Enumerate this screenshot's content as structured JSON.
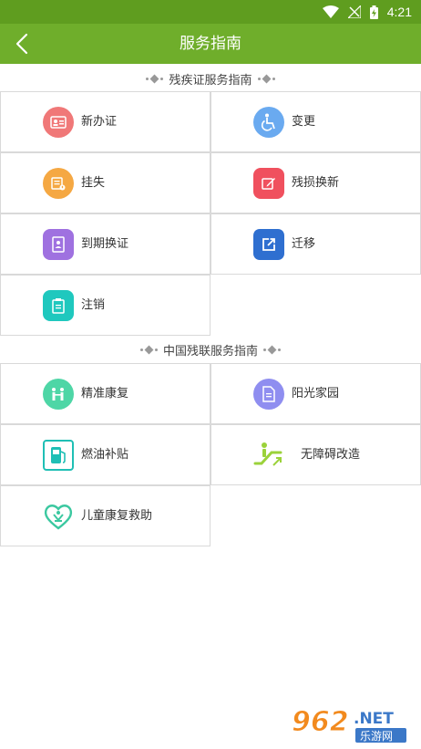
{
  "status": {
    "time": "4:21"
  },
  "header": {
    "title": "服务指南"
  },
  "sections": [
    {
      "title": "残疾证服务指南",
      "items": [
        {
          "label": "新办证",
          "icon": "id-card-icon",
          "color": "#f07878"
        },
        {
          "label": "变更",
          "icon": "wheelchair-icon",
          "color": "#6aaaf0"
        },
        {
          "label": "挂失",
          "icon": "report-loss-icon",
          "color": "#f5a843"
        },
        {
          "label": "残损换新",
          "icon": "edit-icon",
          "color": "#f0505e"
        },
        {
          "label": "到期换证",
          "icon": "contact-book-icon",
          "color": "#9f71e0"
        },
        {
          "label": "迁移",
          "icon": "transfer-icon",
          "color": "#2f6fd0"
        },
        {
          "label": "注销",
          "icon": "clipboard-icon",
          "color": "#1fc8be"
        }
      ]
    },
    {
      "title": "中国残联服务指南",
      "items": [
        {
          "label": "精准康复",
          "icon": "rehab-icon",
          "color": "#4ed6a6"
        },
        {
          "label": "阳光家园",
          "icon": "document-icon",
          "color": "#8f8ef0"
        },
        {
          "label": "燃油补贴",
          "icon": "fuel-icon",
          "color": "#1fbfb5"
        },
        {
          "label": "无障碍改造",
          "icon": "escalator-icon",
          "color": "#9bd23a"
        },
        {
          "label": "儿童康复救助",
          "icon": "heart-child-icon",
          "color": "#3bc8a0"
        }
      ]
    }
  ],
  "watermark": {
    "text": "962.NET",
    "subtext": "乐游网"
  }
}
